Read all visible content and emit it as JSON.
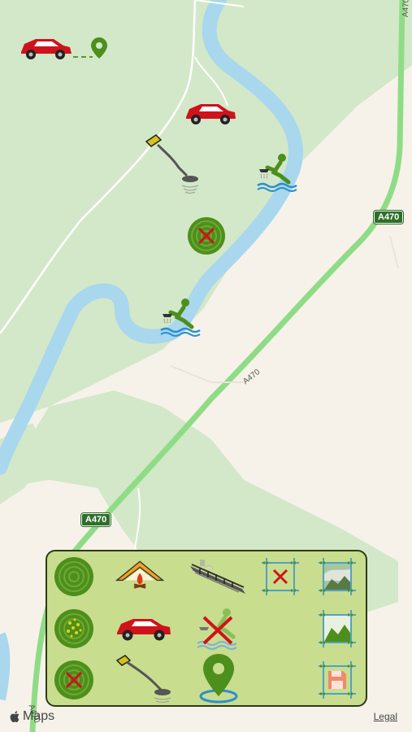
{
  "map": {
    "road_label_top": "A470",
    "road_label_bottom": "A470",
    "road_text": "A470",
    "road_text_left": "A470",
    "attribution": "Maps",
    "legal": "Legal"
  },
  "markers": [
    {
      "name": "car-route-to-pin-icon",
      "icon": "car-with-pin"
    },
    {
      "name": "parked-car-icon",
      "icon": "car"
    },
    {
      "name": "metal-detector-icon",
      "icon": "metal-detector"
    },
    {
      "name": "river-fishing-icon-upper",
      "icon": "water-sampling"
    },
    {
      "name": "no-signal-zone-icon",
      "icon": "signal-crossed"
    },
    {
      "name": "river-fishing-icon-lower",
      "icon": "water-sampling"
    }
  ],
  "toolbar": {
    "items": [
      {
        "name": "signal-zone-button",
        "icon": "signal-rings"
      },
      {
        "name": "camp-fire-tent-button",
        "icon": "tent-fire"
      },
      {
        "name": "bridge-button",
        "icon": "bridge"
      },
      {
        "name": "delete-area-button",
        "icon": "frame-x"
      },
      {
        "name": "photo-area-button",
        "icon": "frame-photo"
      },
      {
        "name": "finds-zone-button",
        "icon": "signal-dots"
      },
      {
        "name": "car-button",
        "icon": "car"
      },
      {
        "name": "no-water-sampling-button",
        "icon": "water-crossed"
      },
      {
        "name": "landscape-area-button",
        "icon": "frame-landscape"
      },
      {
        "name": "no-signal-zone-button",
        "icon": "signal-crossed"
      },
      {
        "name": "metal-detector-button",
        "icon": "metal-detector"
      },
      {
        "name": "location-pin-button",
        "icon": "map-pin"
      },
      {
        "name": "save-area-button",
        "icon": "frame-save"
      }
    ]
  },
  "colors": {
    "land": "#f6f2e9",
    "park": "#cfe6c6",
    "river": "#a8d7ee",
    "road": "#8fdc86",
    "panel": "#c8dd8e",
    "accent_green": "#4d8f1c",
    "car_red": "#d0121b"
  }
}
